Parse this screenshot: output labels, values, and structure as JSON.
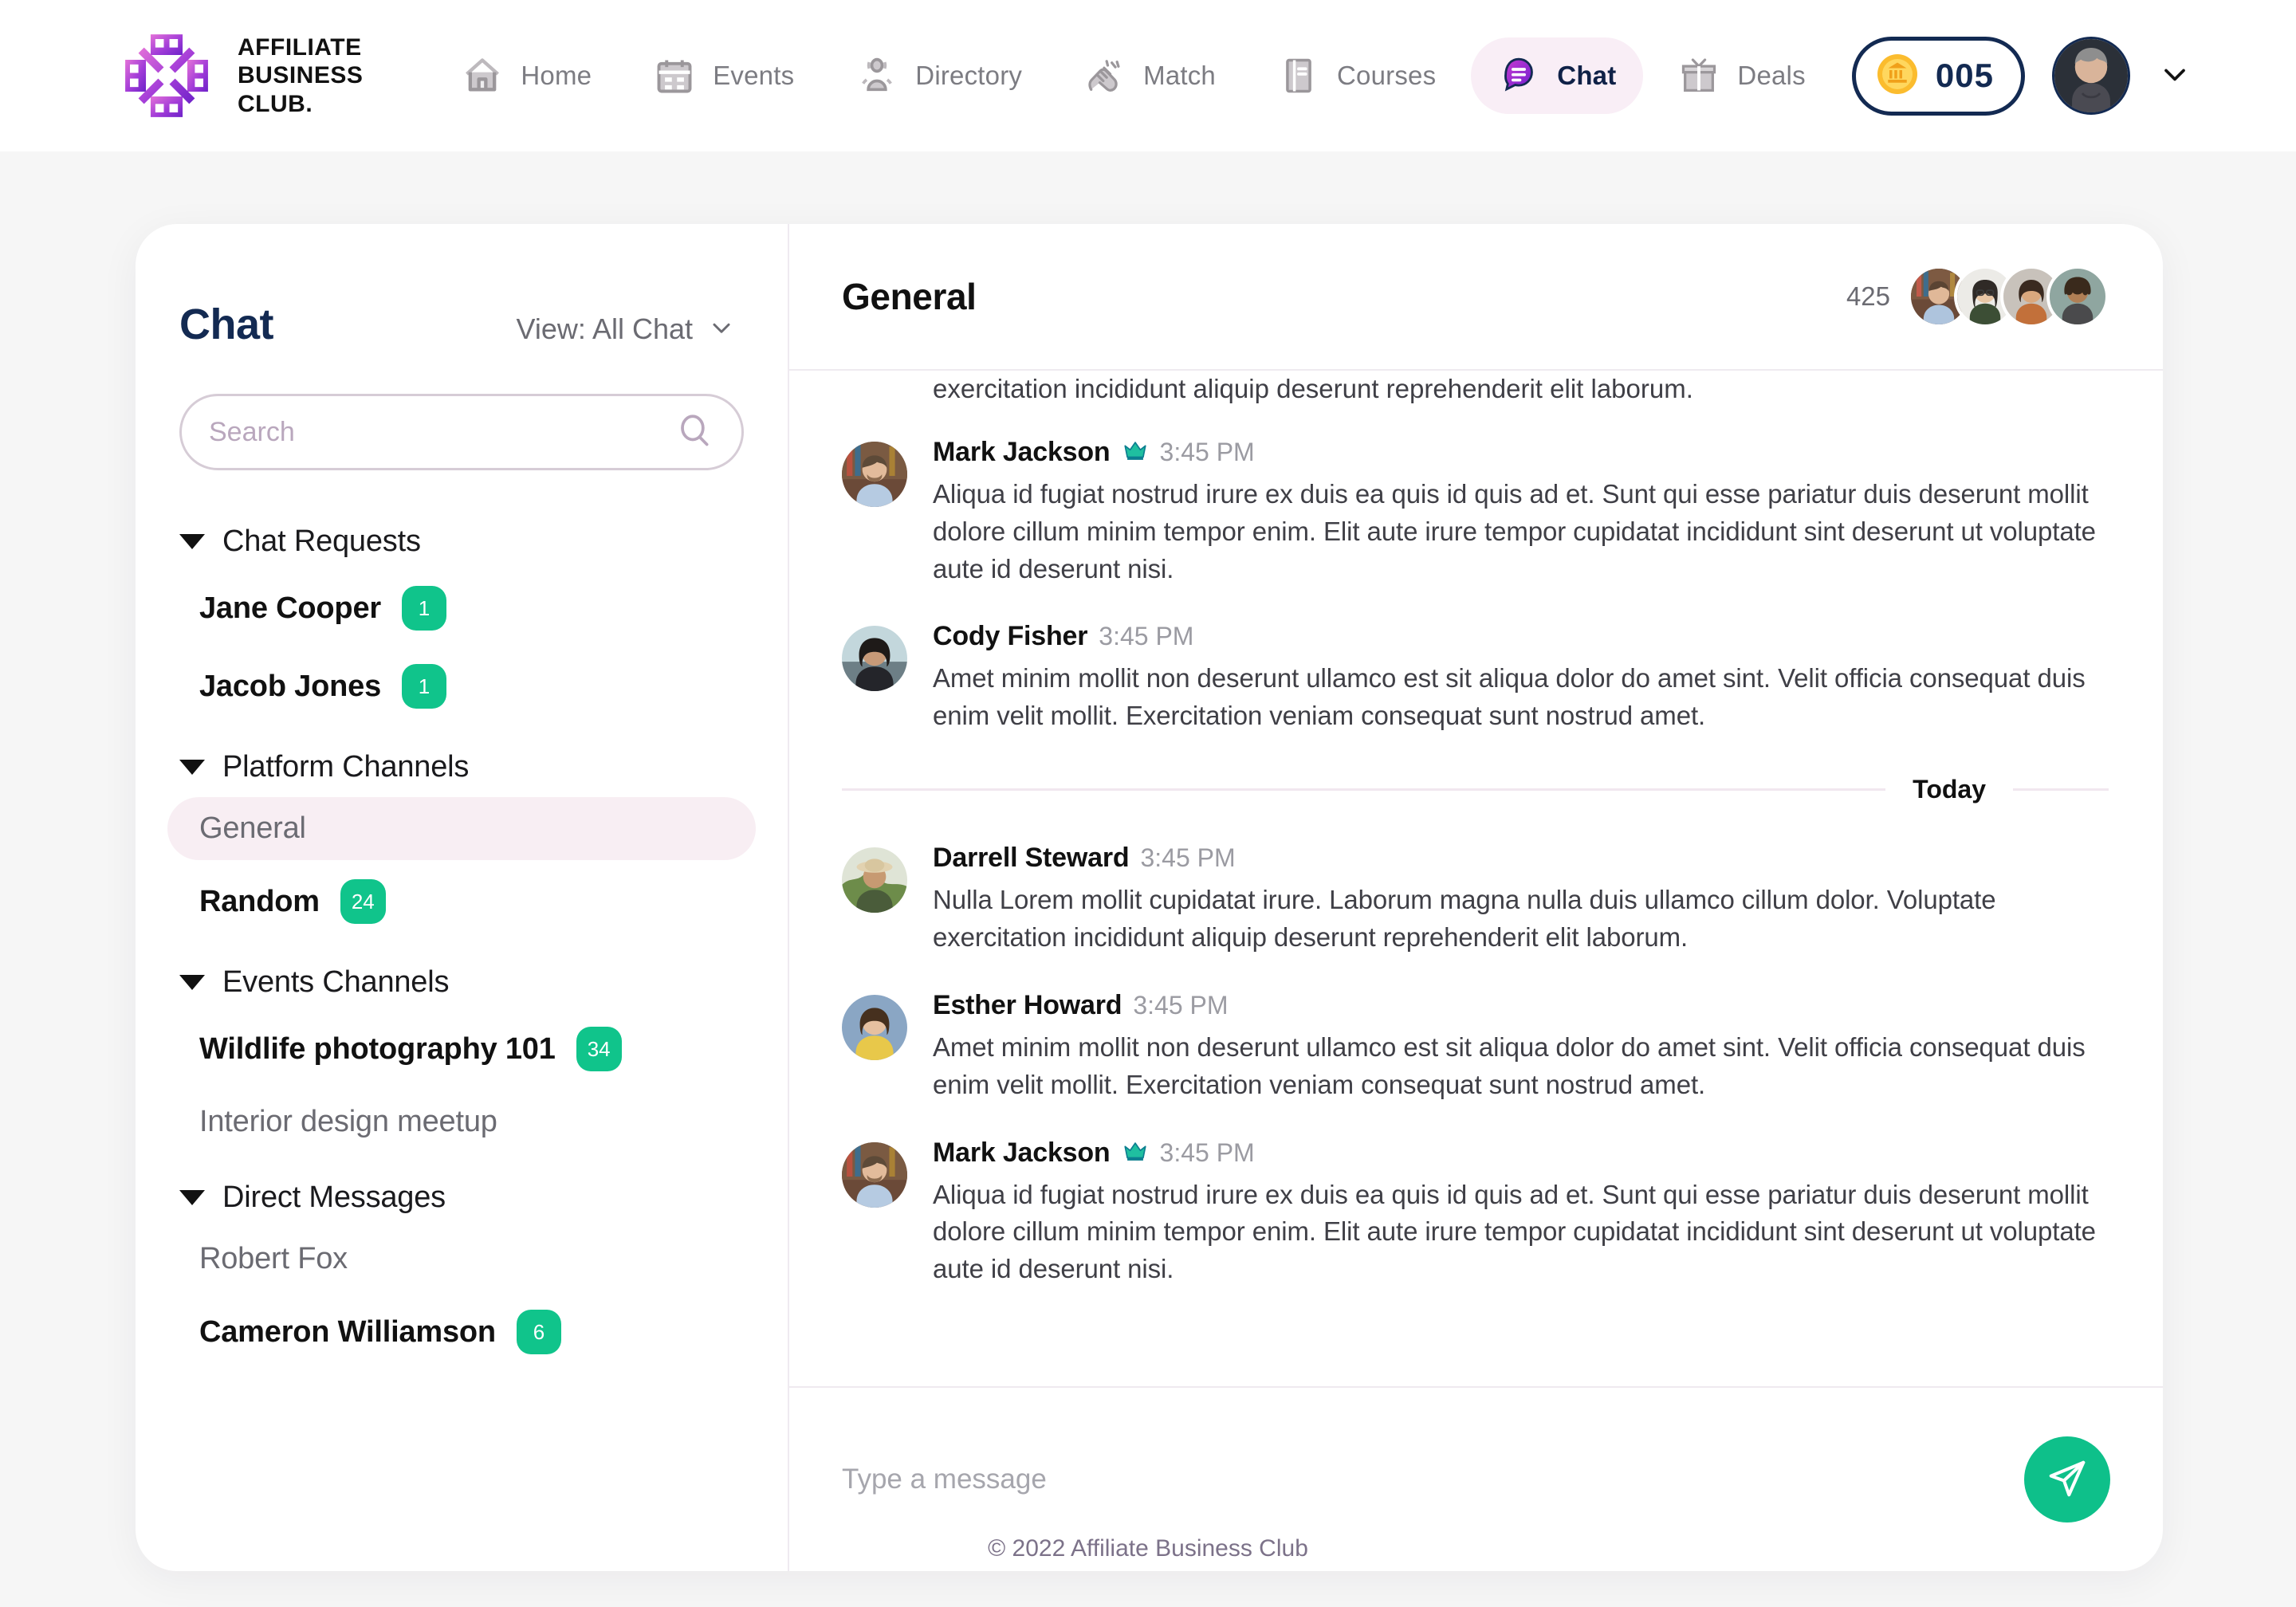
{
  "brand": {
    "name_lines": [
      "AFFILIATE",
      "BUSINESS",
      "CLUB."
    ],
    "logo_icon": "knot-logo-icon",
    "gradient_from": "#e472d8",
    "gradient_to": "#6d22c8"
  },
  "nav": {
    "items": [
      {
        "label": "Home",
        "icon": "house-icon",
        "active": false
      },
      {
        "label": "Events",
        "icon": "calendar-icon",
        "active": false
      },
      {
        "label": "Directory",
        "icon": "people-icon",
        "active": false
      },
      {
        "label": "Match",
        "icon": "handshake-icon",
        "active": false
      },
      {
        "label": "Courses",
        "icon": "book-icon",
        "active": false
      },
      {
        "label": "Chat",
        "icon": "speech-bubble-icon",
        "active": true
      },
      {
        "label": "Deals",
        "icon": "gift-icon",
        "active": false
      }
    ],
    "coin": {
      "icon": "coin-icon",
      "amount": "005"
    },
    "account": {
      "avatar": "user-avatar",
      "caret": "chevron-down-icon"
    },
    "active_bg": "#f9eef6",
    "active_color": "#0f2147"
  },
  "sidebar": {
    "title": "Chat",
    "view_filter": {
      "label": "View: All Chat",
      "caret": "chevron-down-icon"
    },
    "search": {
      "placeholder": "Search",
      "value": "",
      "icon": "search-icon"
    },
    "groups": [
      {
        "label": "Chat Requests",
        "caret": "triangle-down-icon",
        "items": [
          {
            "label": "Jane Cooper",
            "badge": "1",
            "state": "unread"
          },
          {
            "label": "Jacob Jones",
            "badge": "1",
            "state": "unread"
          }
        ]
      },
      {
        "label": "Platform Channels",
        "caret": "triangle-down-icon",
        "items": [
          {
            "label": "General",
            "badge": "",
            "state": "selected"
          },
          {
            "label": "Random",
            "badge": "24",
            "state": "unread"
          }
        ]
      },
      {
        "label": "Events Channels",
        "caret": "triangle-down-icon",
        "items": [
          {
            "label": "Wildlife photography 101",
            "badge": "34",
            "state": "unread"
          },
          {
            "label": "Interior design meetup",
            "badge": "",
            "state": "read"
          }
        ]
      },
      {
        "label": "Direct Messages",
        "caret": "triangle-down-icon",
        "items": [
          {
            "label": "Robert Fox",
            "badge": "",
            "state": "read"
          },
          {
            "label": "Cameron Williamson",
            "badge": "6",
            "state": "unread"
          }
        ]
      }
    ],
    "badge_color": "#10c48b",
    "selected_bg": "#f8eef3"
  },
  "chat": {
    "title": "General",
    "members_count": "425",
    "member_avatars": [
      "member-avatar-1",
      "member-avatar-2",
      "member-avatar-3",
      "member-avatar-4"
    ],
    "partial_message_text": "exercitation incididunt aliquip deserunt reprehenderit elit laborum.",
    "messages_before_divider": [
      {
        "author": "Mark Jackson",
        "badge_icon": "crown-icon",
        "time": "3:45 PM",
        "text": "Aliqua id fugiat nostrud irure ex duis ea quis id quis ad et. Sunt qui esse pariatur duis deserunt mollit dolore cillum minim tempor enim. Elit aute irure tempor cupidatat incididunt sint deserunt ut voluptate aute id deserunt nisi.",
        "avatar": "mark-jackson-avatar"
      },
      {
        "author": "Cody Fisher",
        "badge_icon": "",
        "time": "3:45 PM",
        "text": "Amet minim mollit non deserunt ullamco est sit aliqua dolor do amet sint. Velit officia consequat duis enim velit mollit. Exercitation veniam consequat sunt nostrud amet.",
        "avatar": "cody-fisher-avatar"
      }
    ],
    "day_divider": "Today",
    "messages_after_divider": [
      {
        "author": "Darrell Steward",
        "badge_icon": "",
        "time": "3:45 PM",
        "text": "Nulla Lorem mollit cupidatat irure. Laborum magna nulla duis ullamco cillum dolor. Voluptate exercitation incididunt aliquip deserunt reprehenderit elit laborum.",
        "avatar": "darrell-steward-avatar"
      },
      {
        "author": "Esther Howard",
        "badge_icon": "",
        "time": "3:45 PM",
        "text": "Amet minim mollit non deserunt ullamco est sit aliqua dolor do amet sint. Velit officia consequat duis enim velit mollit. Exercitation veniam consequat sunt nostrud amet.",
        "avatar": "esther-howard-avatar"
      },
      {
        "author": "Mark Jackson",
        "badge_icon": "crown-icon",
        "time": "3:45 PM",
        "text": "Aliqua id fugiat nostrud irure ex duis ea quis id quis ad et. Sunt qui esse pariatur duis deserunt mollit dolore cillum minim tempor enim. Elit aute irure tempor cupidatat incididunt sint deserunt ut voluptate aute id deserunt nisi.",
        "avatar": "mark-jackson-avatar"
      }
    ],
    "composer": {
      "placeholder": "Type a message",
      "value": "",
      "send_icon": "send-plane-icon",
      "send_color": "#0ec08a"
    }
  },
  "footer": {
    "text": "© 2022 Affiliate Business Club"
  }
}
